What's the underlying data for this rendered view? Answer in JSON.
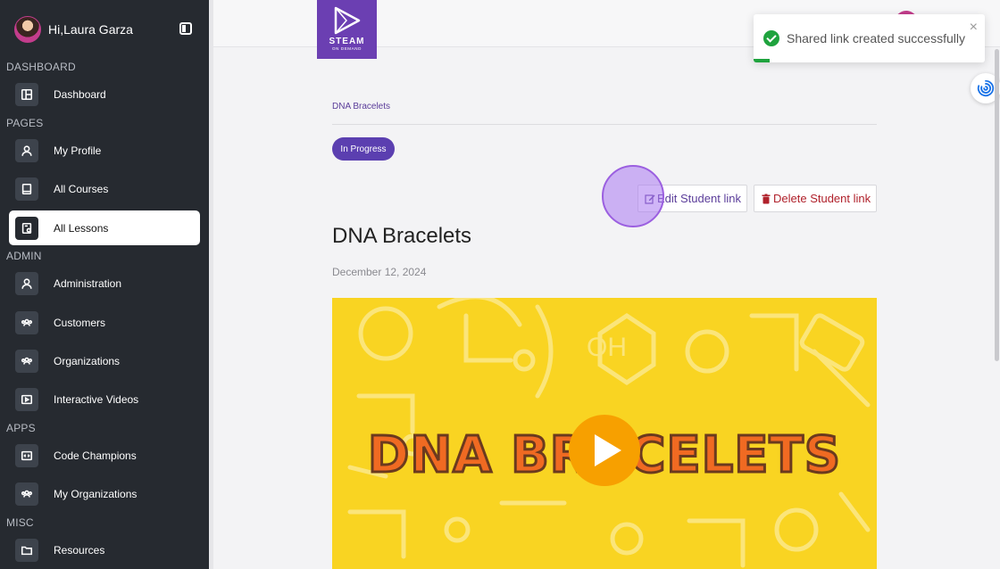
{
  "sidebar": {
    "greeting": "Hi,Laura Garza",
    "sections": [
      "DASHBOARD",
      "PAGES",
      "ADMIN",
      "APPS",
      "MISC"
    ],
    "items": [
      {
        "label": "Dashboard",
        "icon": "dashboard-icon"
      },
      {
        "label": "My Profile",
        "icon": "user-icon"
      },
      {
        "label": "All Courses",
        "icon": "book-icon"
      },
      {
        "label": "All Lessons",
        "icon": "lesson-icon",
        "active": true
      },
      {
        "label": "Administration",
        "icon": "user-icon"
      },
      {
        "label": "Customers",
        "icon": "people-icon"
      },
      {
        "label": "Organizations",
        "icon": "people-icon"
      },
      {
        "label": "Interactive Videos",
        "icon": "video-icon"
      },
      {
        "label": "Code Champions",
        "icon": "code-icon"
      },
      {
        "label": "My Organizations",
        "icon": "people-icon"
      },
      {
        "label": "Resources",
        "icon": "folder-icon"
      }
    ]
  },
  "logo": {
    "line1": "STEAM",
    "line2": "ON DEMAND"
  },
  "main": {
    "breadcrumb": "DNA Bracelets",
    "status": "In Progress",
    "edit_button": "Edit Student link",
    "delete_button": "Delete Student link",
    "title": "DNA Bracelets",
    "date": "December 12, 2024",
    "video_title": "DNA BRACELETS"
  },
  "toast": {
    "message": "Shared link created successfully",
    "close": "×",
    "progress": 0.07
  },
  "colors": {
    "sidebar_bg": "#262a30",
    "accent": "#5b3fb0",
    "danger": "#b0212b",
    "success": "#1fa33e",
    "video_bg": "#f9d422"
  }
}
